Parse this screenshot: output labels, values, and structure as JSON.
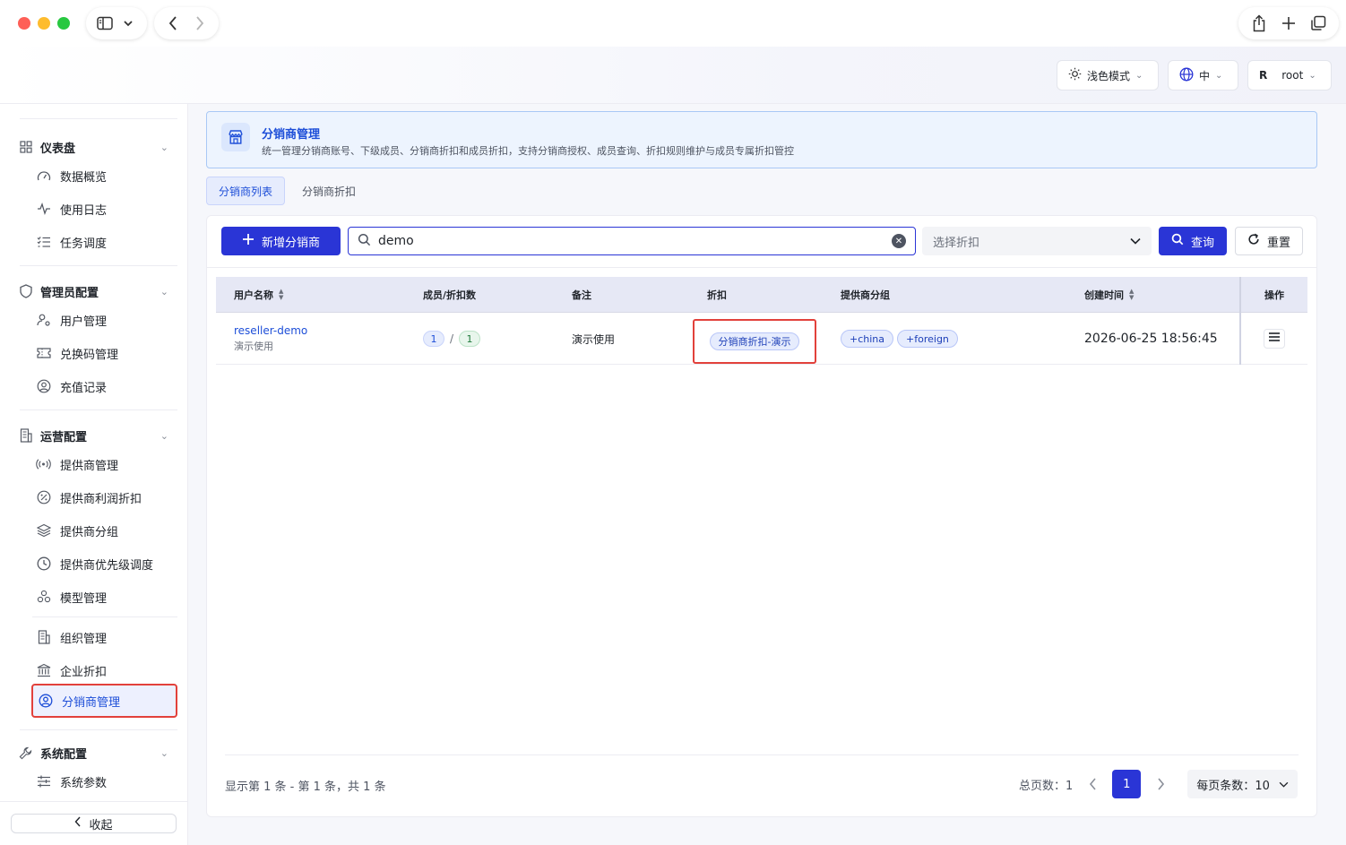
{
  "header": {
    "theme_label": "浅色模式",
    "lang_label": "中",
    "user_initial": "R",
    "user_name": "root"
  },
  "sidebar": {
    "groups": [
      {
        "label": "仪表盘",
        "icon": "grid-icon",
        "items": [
          {
            "label": "数据概览",
            "icon": "gauge-icon"
          },
          {
            "label": "使用日志",
            "icon": "activity-icon"
          },
          {
            "label": "任务调度",
            "icon": "task-list-icon"
          }
        ]
      },
      {
        "label": "管理员配置",
        "icon": "shield-icon",
        "items": [
          {
            "label": "用户管理",
            "icon": "user-gear-icon"
          },
          {
            "label": "兑换码管理",
            "icon": "ticket-icon"
          },
          {
            "label": "充值记录",
            "icon": "user-circle-icon"
          }
        ]
      },
      {
        "label": "运营配置",
        "icon": "building-icon",
        "items": [
          {
            "label": "提供商管理",
            "icon": "radio-icon"
          },
          {
            "label": "提供商利润折扣",
            "icon": "percent-icon"
          },
          {
            "label": "提供商分组",
            "icon": "layers-icon"
          },
          {
            "label": "提供商优先级调度",
            "icon": "clock-icon"
          },
          {
            "label": "模型管理",
            "icon": "cubes-icon"
          },
          {
            "label": "组织管理",
            "icon": "building-icon"
          },
          {
            "label": "企业折扣",
            "icon": "bank-icon"
          },
          {
            "label": "分销商管理",
            "icon": "user-circle-icon",
            "active": true
          }
        ]
      },
      {
        "label": "系统配置",
        "icon": "wrench-icon",
        "items": [
          {
            "label": "系统参数",
            "icon": "sliders-icon"
          }
        ]
      }
    ],
    "collapse_label": "收起"
  },
  "banner": {
    "title": "分销商管理",
    "description": "统一管理分销商账号、下级成员、分销商折扣和成员折扣，支持分销商授权、成员查询、折扣规则维护与成员专属折扣管控"
  },
  "tabs": [
    {
      "label": "分销商列表",
      "active": true
    },
    {
      "label": "分销商折扣",
      "active": false
    }
  ],
  "toolbar": {
    "add_label": "新增分销商",
    "search_value": "demo",
    "select_placeholder": "选择折扣",
    "query_label": "查询",
    "reset_label": "重置"
  },
  "table": {
    "columns": [
      "用户名称",
      "成员/折扣数",
      "备注",
      "折扣",
      "提供商分组",
      "创建时间",
      "操作"
    ],
    "rows": [
      {
        "username": "reseller-demo",
        "sub": "演示使用",
        "members": "1",
        "discounts": "1",
        "remark": "演示使用",
        "discount_tag": "分销商折扣-演示",
        "groups": [
          "+china",
          "+foreign"
        ],
        "created": "2026-06-25 18:56:45"
      }
    ]
  },
  "footer": {
    "info": "显示第 1 条 - 第 1 条，共 1 条",
    "total_pages_label": "总页数：",
    "total_pages": "1",
    "current_page": "1",
    "page_size_label": "每页条数：",
    "page_size": "10"
  },
  "colors": {
    "primary": "#2a35d6",
    "highlight_red": "#e2413b",
    "link_blue": "#1d4ed8"
  }
}
